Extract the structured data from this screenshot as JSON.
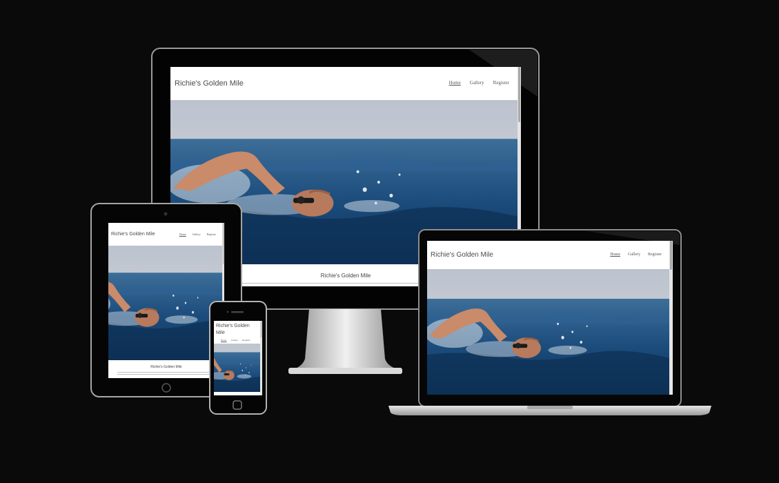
{
  "site": {
    "title": "Richie's Golden Mile",
    "nav": [
      "Home",
      "Gallery",
      "Register"
    ],
    "active_nav": "Home",
    "section_heading": "Richie's Golden Mile"
  },
  "devices": [
    "desktop-monitor",
    "tablet",
    "smartphone",
    "laptop"
  ],
  "hero_image": "swimmer-in-open-sea-photo",
  "colors": {
    "background": "#0b0a0a",
    "sea": "#1f4f7f",
    "sky": "#c8ccd3",
    "title_text": "#4a4a4a"
  }
}
